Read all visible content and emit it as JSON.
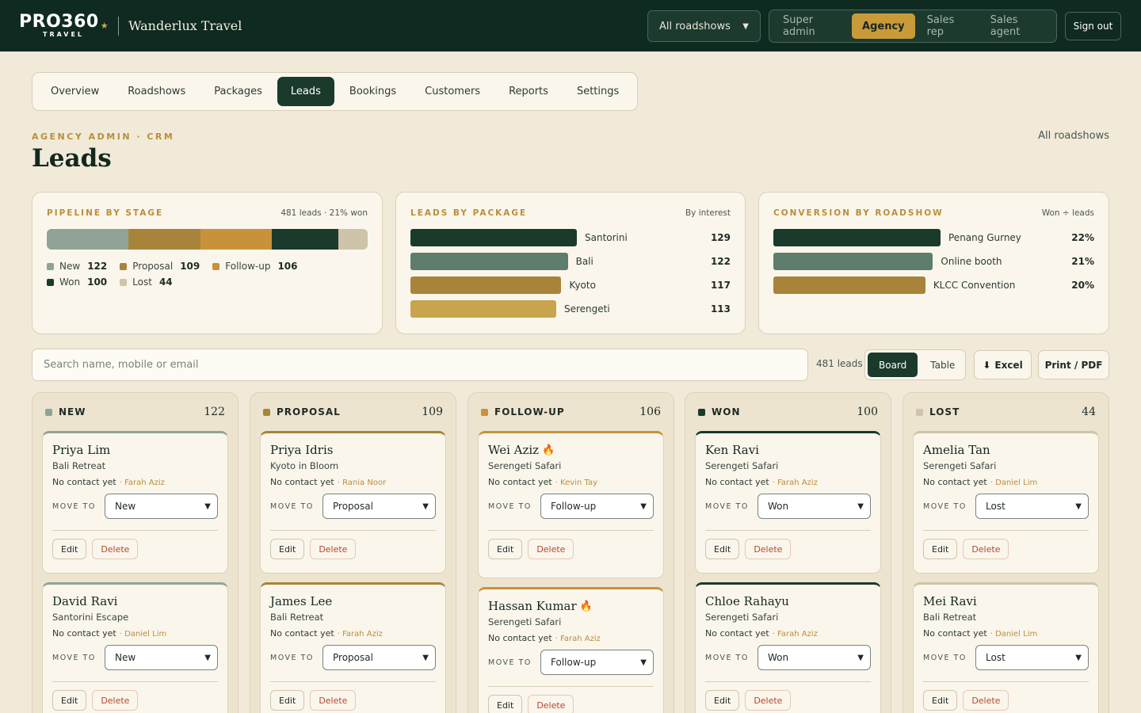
{
  "header": {
    "logo_main": "PRO360",
    "logo_sub": "TRAVEL",
    "brand": "Wanderlux Travel",
    "roadshow_select": "All roadshows",
    "roles": [
      "Super admin",
      "Agency",
      "Sales rep",
      "Sales agent"
    ],
    "active_role": "Agency",
    "sign_out": "Sign out"
  },
  "nav": {
    "tabs": [
      "Overview",
      "Roadshows",
      "Packages",
      "Leads",
      "Bookings",
      "Customers",
      "Reports",
      "Settings"
    ],
    "active": "Leads"
  },
  "page": {
    "eyebrow": "AGENCY ADMIN · CRM",
    "title": "Leads",
    "roadshow_label": "All roadshows"
  },
  "pipeline": {
    "title": "PIPELINE BY STAGE",
    "meta": "481 leads · 21% won",
    "stages": [
      {
        "name": "New",
        "count": 122,
        "color": "#8fa496"
      },
      {
        "name": "Proposal",
        "count": 109,
        "color": "#a8843a"
      },
      {
        "name": "Follow-up",
        "count": 106,
        "color": "#c8923a"
      },
      {
        "name": "Won",
        "count": 100,
        "color": "#1a3a2c"
      },
      {
        "name": "Lost",
        "count": 44,
        "color": "#cfc3a9"
      }
    ]
  },
  "by_package": {
    "title": "LEADS BY PACKAGE",
    "meta": "By interest",
    "rows": [
      {
        "label": "Santorini",
        "value": 129,
        "color": "#1a3a2c"
      },
      {
        "label": "Bali",
        "value": 122,
        "color": "#5e7d6c"
      },
      {
        "label": "Kyoto",
        "value": 117,
        "color": "#a8843a"
      },
      {
        "label": "Serengeti",
        "value": 113,
        "color": "#c8a44e"
      }
    ]
  },
  "by_roadshow": {
    "title": "CONVERSION BY ROADSHOW",
    "meta": "Won ÷ leads",
    "rows": [
      {
        "label": "Penang Gurney",
        "value": "22%",
        "pct": 22,
        "color": "#1a3a2c"
      },
      {
        "label": "Online booth",
        "value": "21%",
        "pct": 21,
        "color": "#5e7d6c"
      },
      {
        "label": "KLCC Convention",
        "value": "20%",
        "pct": 20,
        "color": "#a8843a"
      }
    ]
  },
  "toolbar": {
    "search_placeholder": "Search name, mobile or email",
    "count": "481 leads",
    "board": "Board",
    "table": "Table",
    "excel": "Excel",
    "excel_icon": "⬇",
    "print": "Print / PDF"
  },
  "board": {
    "move_label": "MOVE TO",
    "edit": "Edit",
    "delete": "Delete",
    "columns": [
      {
        "title": "NEW",
        "count": "122",
        "color": "#8fa496",
        "leads": [
          {
            "name": "Priya Lim",
            "pkg": "Bali Retreat",
            "contact": "No contact yet",
            "agent": "· Farah Aziz",
            "stage": "New",
            "hot": false
          },
          {
            "name": "David Ravi",
            "pkg": "Santorini Escape",
            "contact": "No contact yet",
            "agent": "· Daniel Lim",
            "stage": "New",
            "hot": false
          }
        ]
      },
      {
        "title": "PROPOSAL",
        "count": "109",
        "color": "#a8843a",
        "leads": [
          {
            "name": "Priya Idris",
            "pkg": "Kyoto in Bloom",
            "contact": "No contact yet",
            "agent": "· Rania Noor",
            "stage": "Proposal",
            "hot": false
          },
          {
            "name": "James Lee",
            "pkg": "Bali Retreat",
            "contact": "No contact yet",
            "agent": "· Farah Aziz",
            "stage": "Proposal",
            "hot": false
          }
        ]
      },
      {
        "title": "FOLLOW-UP",
        "count": "106",
        "color": "#c8923a",
        "leads": [
          {
            "name": "Wei Aziz",
            "pkg": "Serengeti Safari",
            "contact": "No contact yet",
            "agent": "· Kevin Tay",
            "stage": "Follow-up",
            "hot": true
          },
          {
            "name": "Hassan Kumar",
            "pkg": "Serengeti Safari",
            "contact": "No contact yet",
            "agent": "· Farah Aziz",
            "stage": "Follow-up",
            "hot": true
          }
        ]
      },
      {
        "title": "WON",
        "count": "100",
        "color": "#1a3a2c",
        "leads": [
          {
            "name": "Ken Ravi",
            "pkg": "Serengeti Safari",
            "contact": "No contact yet",
            "agent": "· Farah Aziz",
            "stage": "Won",
            "hot": false
          },
          {
            "name": "Chloe Rahayu",
            "pkg": "Serengeti Safari",
            "contact": "No contact yet",
            "agent": "· Farah Aziz",
            "stage": "Won",
            "hot": false
          }
        ]
      },
      {
        "title": "LOST",
        "count": "44",
        "color": "#cfc3a9",
        "leads": [
          {
            "name": "Amelia Tan",
            "pkg": "Serengeti Safari",
            "contact": "No contact yet",
            "agent": "· Daniel Lim",
            "stage": "Lost",
            "hot": false
          },
          {
            "name": "Mei Ravi",
            "pkg": "Bali Retreat",
            "contact": "No contact yet",
            "agent": "· Daniel Lim",
            "stage": "Lost",
            "hot": false
          }
        ]
      }
    ]
  }
}
